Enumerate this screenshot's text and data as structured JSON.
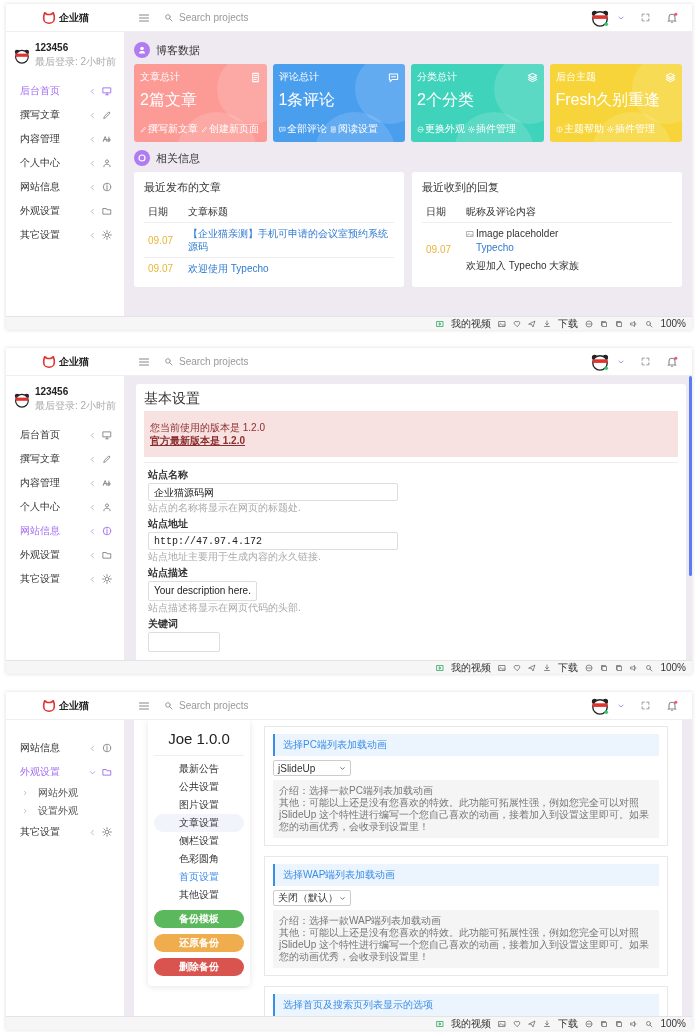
{
  "screens": [
    {
      "kind": "dashboard",
      "logo": "企业猫",
      "search": {
        "placeholder": "Search projects"
      },
      "profile": {
        "name": "123456",
        "last_login": "最后登录: 2小时前"
      },
      "sidebar": [
        {
          "label": "后台首页",
          "selected": true,
          "expanded": false
        },
        {
          "label": "撰写文章",
          "selected": false,
          "expanded": false
        },
        {
          "label": "内容管理",
          "selected": false,
          "expanded": false
        },
        {
          "label": "个人中心",
          "selected": false,
          "expanded": false
        },
        {
          "label": "网站信息",
          "selected": false,
          "expanded": false
        },
        {
          "label": "外观设置",
          "selected": false,
          "expanded": false
        },
        {
          "label": "其它设置",
          "selected": false,
          "expanded": false
        }
      ],
      "stats": {
        "title": "博客数据",
        "cards": [
          {
            "label": "文章总计",
            "value": "2篇文章",
            "links": [
              "撰写新文章",
              "创建新页面"
            ],
            "color": "#fc9a96"
          },
          {
            "label": "评论总计",
            "value": "1条评论",
            "links": [
              "全部评论",
              "阅读设置"
            ],
            "color": "#4a9eee"
          },
          {
            "label": "分类总计",
            "value": "2个分类",
            "links": [
              "更换外观",
              "插件管理"
            ],
            "color": "#40d3bb"
          },
          {
            "label": "后台主题",
            "value": "Fresh久别重逢",
            "links": [
              "主题帮助",
              "插件管理"
            ],
            "color": "#f7d53a"
          }
        ]
      },
      "related": {
        "title": "相关信息",
        "posts": {
          "title": "最近发布的文章",
          "columns": [
            "日期",
            "文章标题"
          ],
          "rows": [
            {
              "date": "09.07",
              "title": "【企业猫亲测】手机可申请的会议室预约系统源码"
            },
            {
              "date": "09.07",
              "title": "欢迎使用 Typecho"
            }
          ]
        },
        "replies": {
          "title": "最近收到的回复",
          "columns": [
            "日期",
            "昵称及评论内容"
          ],
          "rows": [
            {
              "date": "09.07",
              "image_alt": "Image placeholder",
              "author": "Typecho",
              "comment": "欢迎加入 Typecho 大家族"
            }
          ]
        }
      },
      "status_bar": {
        "video": "我的视频",
        "download": "下载",
        "zoom": "100%"
      }
    },
    {
      "kind": "settings",
      "logo": "企业猫",
      "search": {
        "placeholder": "Search projects"
      },
      "profile": {
        "name": "123456",
        "last_login": "最后登录: 2小时前"
      },
      "sidebar": [
        {
          "label": "后台首页",
          "selected": false,
          "expanded": false
        },
        {
          "label": "撰写文章",
          "selected": false,
          "expanded": false
        },
        {
          "label": "内容管理",
          "selected": false,
          "expanded": false
        },
        {
          "label": "个人中心",
          "selected": false,
          "expanded": false
        },
        {
          "label": "网站信息",
          "selected": true,
          "expanded": false
        },
        {
          "label": "外观设置",
          "selected": false,
          "expanded": false
        },
        {
          "label": "其它设置",
          "selected": false,
          "expanded": false
        }
      ],
      "settings": {
        "title": "基本设置",
        "notice": {
          "current": "您当前使用的版本是 1.2.0",
          "latest": "官方最新版本是 1.2.0"
        },
        "fields": [
          {
            "kind": "input",
            "label": "站点名称",
            "value": "企业猫源码网",
            "hint": "站点的名称将显示在网页的标题处."
          },
          {
            "kind": "url",
            "label": "站点地址",
            "value": "http://47.97.4.172",
            "hint": "站点地址主要用于生成内容的永久链接."
          },
          {
            "kind": "textarea",
            "label": "站点描述",
            "value": "Your description here.",
            "hint": "站点描述将显示在网页代码的头部."
          },
          {
            "kind": "textarea",
            "label": "关键词"
          }
        ]
      },
      "status_bar": {
        "video": "我的视频",
        "download": "下载",
        "zoom": "100%"
      }
    },
    {
      "kind": "theme",
      "logo": "企业猫",
      "search": {
        "placeholder": "Search projects"
      },
      "sidebar": [
        {
          "label": "网站信息",
          "selected": false,
          "expanded": false
        },
        {
          "label": "外观设置",
          "selected": true,
          "expanded": true,
          "children": [
            "网站外观",
            "设置外观"
          ]
        },
        {
          "label": "其它设置",
          "selected": false,
          "expanded": false
        }
      ],
      "theme": {
        "title": "Joe 1.0.0",
        "nav": [
          {
            "label": "最新公告",
            "selected": false,
            "hovered": false
          },
          {
            "label": "公共设置",
            "selected": false,
            "hovered": false
          },
          {
            "label": "图片设置",
            "selected": false,
            "hovered": false
          },
          {
            "label": "文章设置",
            "selected": false,
            "hovered": true
          },
          {
            "label": "侧栏设置",
            "selected": false,
            "hovered": false
          },
          {
            "label": "色彩圆角",
            "selected": false,
            "hovered": false
          },
          {
            "label": "首页设置",
            "selected": true,
            "hovered": false
          },
          {
            "label": "其他设置",
            "selected": false,
            "hovered": false
          }
        ],
        "buttons": [
          {
            "label": "备份模板",
            "color": "#5cb85c"
          },
          {
            "label": "还原备份",
            "color": "#f0ad4e"
          },
          {
            "label": "删除备份",
            "color": "#d9534f"
          }
        ],
        "options": [
          {
            "title": "选择PC端列表加载动画",
            "value": "jSlideUp",
            "intro": "介绍：选择一款PC端列表加载动画",
            "note": "其他：可能以上还是没有您喜欢的特效。此功能可拓展性强，例如您完全可以对照 jSlideUp 这个特性进行编写一个您自己喜欢的动画，接着加入到设置这里即可。如果您的动画优秀，会收录到设置里！"
          },
          {
            "title": "选择WAP端列表加载动画",
            "value": "关闭（默认）",
            "intro": "介绍：选择一款WAP端列表加载动画",
            "note": "其他：可能以上还是没有您喜欢的特效。此功能可拓展性强，例如您完全可以对照 jSlideUp 这个特性进行编写一个您自己喜欢的动画，接着加入到设置这里即可。如果您的动画优秀，会收录到设置里！"
          },
          {
            "title": "选择首页及搜索页列表显示的选项"
          }
        ]
      },
      "status_bar": {
        "video": "我的视频",
        "download": "下载",
        "zoom": "100%"
      }
    }
  ]
}
